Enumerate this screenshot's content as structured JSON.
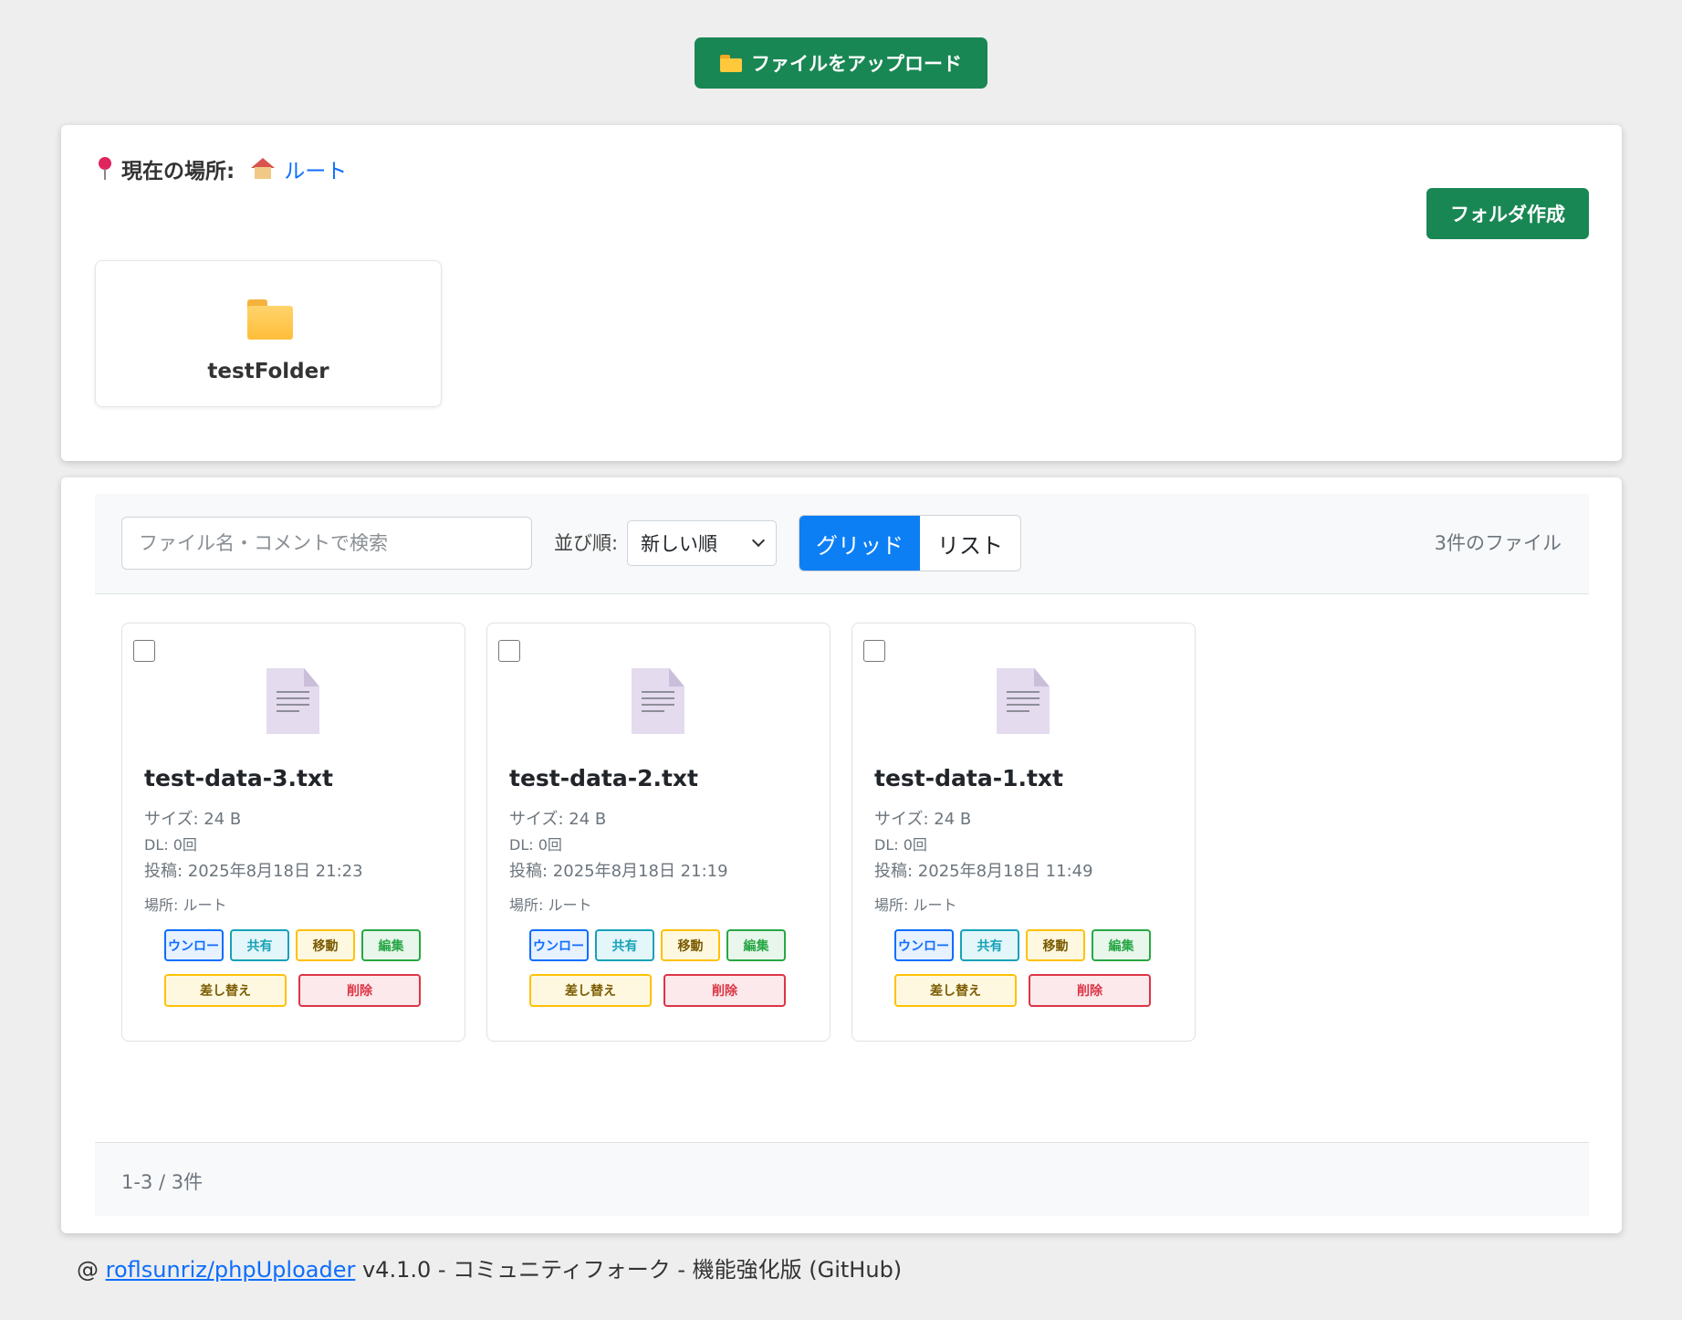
{
  "header": {
    "upload_label": "ファイルをアップロード"
  },
  "location": {
    "label": "現在の場所:",
    "root_link": "ルート"
  },
  "folders": {
    "create_label": "フォルダ作成",
    "items": [
      {
        "name": "testFolder"
      }
    ]
  },
  "toolbar": {
    "search_placeholder": "ファイル名・コメントで検索",
    "sort_label": "並び順:",
    "sort_value": "新しい順",
    "view_grid": "グリッド",
    "view_list": "リスト",
    "file_count": "3件のファイル"
  },
  "files": [
    {
      "name": "test-data-3.txt",
      "size": "サイズ: 24 B",
      "dl": "DL: 0回",
      "posted": "投稿: 2025年8月18日 21:23",
      "place": "場所: ルート"
    },
    {
      "name": "test-data-2.txt",
      "size": "サイズ: 24 B",
      "dl": "DL: 0回",
      "posted": "投稿: 2025年8月18日 21:19",
      "place": "場所: ルート"
    },
    {
      "name": "test-data-1.txt",
      "size": "サイズ: 24 B",
      "dl": "DL: 0回",
      "posted": "投稿: 2025年8月18日 11:49",
      "place": "場所: ルート"
    }
  ],
  "actions": {
    "download": "ウンロー",
    "share": "共有",
    "move": "移動",
    "edit": "編集",
    "replace": "差し替え",
    "delete": "削除"
  },
  "pagination": {
    "info": "1-3 / 3件"
  },
  "footer": {
    "prefix": "@ ",
    "repo_link": "roflsunriz/phpUploader",
    "suffix": " v4.1.0 - コミュニティフォーク - 機能強化版 (GitHub)"
  },
  "colors": {
    "primary_green": "#198754",
    "primary_blue": "#0d6efd",
    "active_view": "#0d7ff5"
  }
}
